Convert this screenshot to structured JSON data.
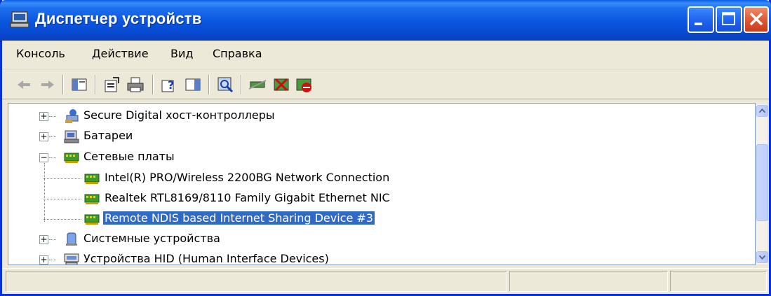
{
  "window": {
    "title": "Диспетчер устройств"
  },
  "menu": {
    "items": [
      "Консоль",
      "Действие",
      "Вид",
      "Справка"
    ]
  },
  "toolbar": {
    "buttons": [
      "back-icon",
      "forward-icon",
      "show-hide-console-tree-icon",
      "properties-icon",
      "print-icon",
      "help-icon",
      "show-action-pane-icon",
      "scan-hardware-icon",
      "update-driver-icon",
      "uninstall-icon",
      "disable-icon"
    ]
  },
  "tree": {
    "rows": [
      {
        "label": "Secure Digital хост-контроллеры",
        "expanded": false,
        "icon": "sd-host-icon",
        "level": 1
      },
      {
        "label": "Батареи",
        "expanded": false,
        "icon": "battery-icon",
        "level": 1
      },
      {
        "label": "Сетевые платы",
        "expanded": true,
        "icon": "network-card-icon",
        "level": 1
      },
      {
        "label": "Intel(R) PRO/Wireless 2200BG Network Connection",
        "icon": "network-card-icon",
        "level": 2
      },
      {
        "label": "Realtek RTL8169/8110 Family Gigabit Ethernet NIC",
        "icon": "network-card-icon",
        "level": 2
      },
      {
        "label": "Remote NDIS based Internet Sharing Device #3",
        "icon": "network-card-icon",
        "level": 2,
        "selected": true
      },
      {
        "label": "Системные устройства",
        "expanded": false,
        "icon": "system-device-icon",
        "level": 1
      },
      {
        "label": "Устройства HID (Human Interface Devices)",
        "expanded": false,
        "icon": "hid-icon",
        "level": 1
      }
    ]
  },
  "colors": {
    "selection": "#316ac5",
    "titlebar": "#0a55de",
    "chrome": "#ece9d8"
  }
}
